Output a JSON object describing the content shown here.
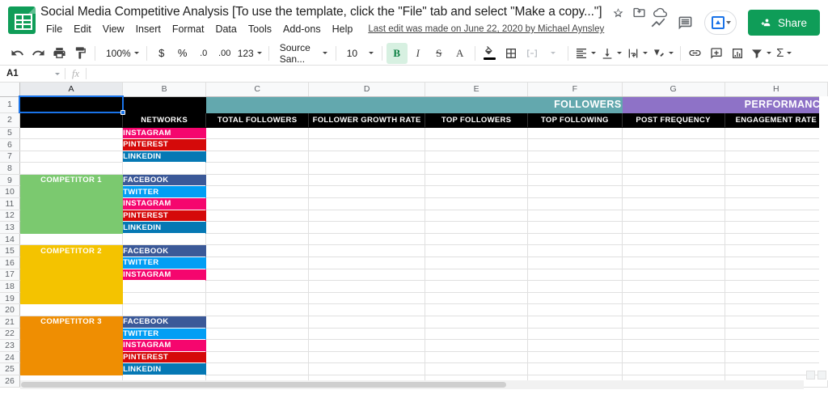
{
  "app": {
    "doc_icon": "sheets-icon",
    "title": "Social Media Competitive Analysis [To use the template, click the \"File\" tab and select \"Make a copy...\"]",
    "star_icon": "star-icon",
    "move_icon": "move-to-folder-icon",
    "cloud_icon": "cloud-saved-icon",
    "menus": [
      "File",
      "Edit",
      "View",
      "Insert",
      "Format",
      "Data",
      "Tools",
      "Add-ons",
      "Help"
    ],
    "last_edit": "Last edit was made on June 22, 2020 by Michael Aynsley",
    "trend_icon": "activity-trend-icon",
    "comment_icon": "comment-icon",
    "present_label": "present-button",
    "share_label": "Share"
  },
  "toolbar": {
    "undo": "undo-icon",
    "redo": "redo-icon",
    "print": "print-icon",
    "paint": "paint-format-icon",
    "zoom": "100%",
    "currency": "$",
    "percent": "%",
    "decimal_dec": ".0",
    "decimal_inc": ".00",
    "more_formats": "123",
    "font": "Source San...",
    "font_size": "10",
    "bold": "B",
    "italic": "I",
    "strikethrough": "S",
    "text_color": "A",
    "fill_color": "fill-color-icon",
    "borders": "borders-icon",
    "merge": "merge-cells-icon",
    "halign": "horizontal-align-icon",
    "valign": "vertical-align-icon",
    "wrap": "text-wrap-icon",
    "rotate": "text-rotation-icon",
    "link": "insert-link-icon",
    "comment": "insert-comment-icon",
    "chart": "insert-chart-icon",
    "filter": "filter-icon",
    "functions": "sum-functions-icon"
  },
  "formula_bar": {
    "name_box": "A1",
    "fx": "fx",
    "value": "",
    "placeholder": ""
  },
  "grid": {
    "columns": [
      {
        "label": "A",
        "width": 130,
        "selected": true
      },
      {
        "label": "B",
        "width": 105,
        "selected": false
      },
      {
        "label": "C",
        "width": 130,
        "selected": false
      },
      {
        "label": "D",
        "width": 148,
        "selected": false
      },
      {
        "label": "E",
        "width": 130,
        "selected": false
      },
      {
        "label": "F",
        "width": 119,
        "selected": false
      },
      {
        "label": "G",
        "width": 130,
        "selected": false
      },
      {
        "label": "H",
        "width": 130,
        "selected": false
      }
    ],
    "row_numbers": [
      1,
      2,
      5,
      6,
      7,
      8,
      9,
      10,
      11,
      12,
      13,
      14,
      15,
      16,
      17,
      18,
      19,
      20,
      21,
      22,
      23,
      24,
      25,
      26
    ],
    "banners": [
      {
        "label": "FOLLOWERS",
        "color": "#63a8ae",
        "from": "C",
        "to": "F"
      },
      {
        "label": "PERFORMANCE",
        "color": "#8e72c7",
        "from": "G",
        "to": "H"
      }
    ],
    "subheaders": [
      "",
      "NETWORKS",
      "TOTAL FOLLOWERS",
      "FOLLOWER GROWTH RATE",
      "TOP FOLLOWERS",
      "TOP FOLLOWING",
      "POST FREQUENCY",
      "ENGAGEMENT RATE"
    ],
    "networks": {
      "FACEBOOK": "#3b5998",
      "TWITTER": "#029ef4",
      "INSTAGRAM": "#f5066e",
      "PINTEREST": "#d50a0a",
      "LINKEDIN": "#0578b4"
    },
    "blocks": [
      {
        "name": "",
        "color": "",
        "rows": [
          {
            "row": 5,
            "network": "INSTAGRAM"
          },
          {
            "row": 6,
            "network": "PINTEREST"
          },
          {
            "row": 7,
            "network": "LINKEDIN"
          },
          {
            "row": 8,
            "network": ""
          }
        ]
      },
      {
        "name": "COMPETITOR 1",
        "color": "#7bc96f",
        "rows": [
          {
            "row": 9,
            "network": "FACEBOOK"
          },
          {
            "row": 10,
            "network": "TWITTER"
          },
          {
            "row": 11,
            "network": "INSTAGRAM"
          },
          {
            "row": 12,
            "network": "PINTEREST"
          },
          {
            "row": 13,
            "network": "LINKEDIN"
          },
          {
            "row": 14,
            "network": ""
          }
        ]
      },
      {
        "name": "COMPETITOR 2",
        "color": "#f4c300",
        "rows": [
          {
            "row": 15,
            "network": "FACEBOOK"
          },
          {
            "row": 16,
            "network": "TWITTER"
          },
          {
            "row": 17,
            "network": "INSTAGRAM"
          },
          {
            "row": 18,
            "network": ""
          },
          {
            "row": 19,
            "network": ""
          },
          {
            "row": 20,
            "network": ""
          }
        ]
      },
      {
        "name": "COMPETITOR 3",
        "color": "#ef8e02",
        "rows": [
          {
            "row": 21,
            "network": "FACEBOOK"
          },
          {
            "row": 22,
            "network": "TWITTER"
          },
          {
            "row": 23,
            "network": "INSTAGRAM"
          },
          {
            "row": 24,
            "network": "PINTEREST"
          },
          {
            "row": 25,
            "network": "LINKEDIN"
          },
          {
            "row": 26,
            "network": ""
          }
        ]
      }
    ],
    "selected_cell": "A1"
  }
}
